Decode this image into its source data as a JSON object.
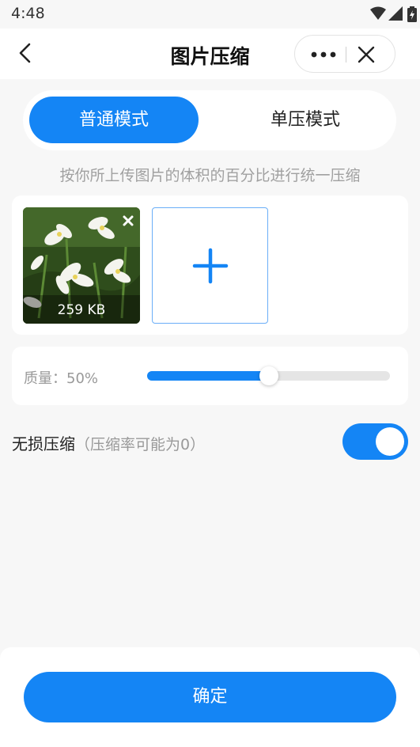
{
  "status_bar": {
    "time": "4:48"
  },
  "nav": {
    "title": "图片压缩"
  },
  "modes": {
    "normal": "普通模式",
    "single": "单压模式",
    "selected": "普通模式"
  },
  "hint": "按你所上传图片的体积的百分比进行统一压缩",
  "images": [
    {
      "size": "259 KB"
    }
  ],
  "quality": {
    "label": "质量：50%",
    "value_fraction": 0.5
  },
  "lossless": {
    "title": "无损压缩",
    "note": "（压缩率可能为0）",
    "enabled": true
  },
  "confirm_label": "确定",
  "colors": {
    "accent": "#1485f5",
    "page_bg": "#f7f7f7"
  },
  "icons": [
    "back-icon",
    "more-icon",
    "close-icon",
    "wifi-icon",
    "signal-icon",
    "battery-icon",
    "remove-icon",
    "plus-icon"
  ]
}
